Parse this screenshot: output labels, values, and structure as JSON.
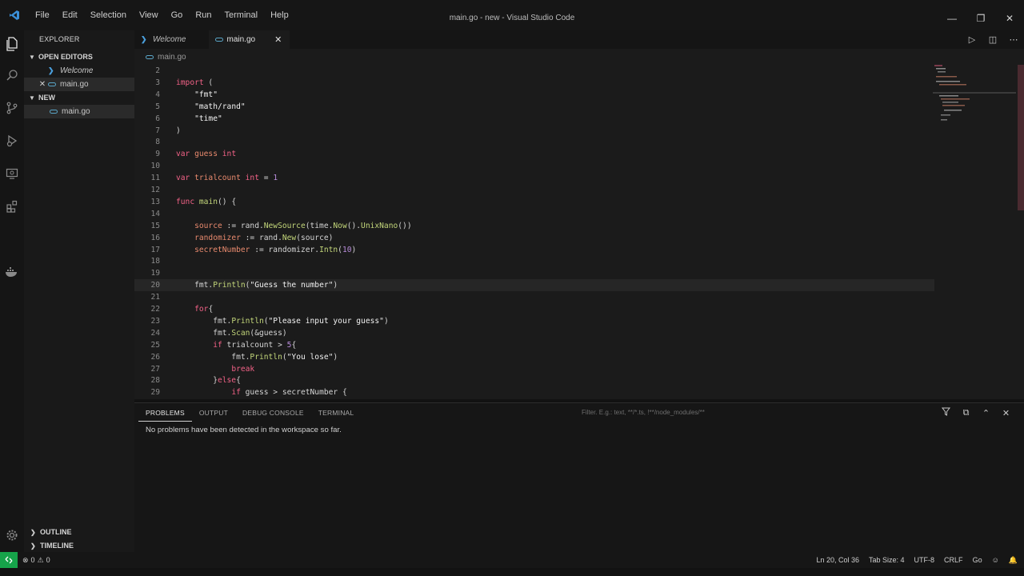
{
  "window": {
    "title": "main.go - new - Visual Studio Code",
    "menu": [
      "File",
      "Edit",
      "Selection",
      "View",
      "Go",
      "Run",
      "Terminal",
      "Help"
    ]
  },
  "sidebar": {
    "header": "EXPLORER",
    "open_editors": {
      "label": "OPEN EDITORS",
      "items": [
        "Welcome",
        "main.go"
      ]
    },
    "folder": {
      "label": "NEW",
      "items": [
        "main.go"
      ]
    },
    "outline": "OUTLINE",
    "timeline": "TIMELINE"
  },
  "tabs": [
    {
      "label": "Welcome",
      "icon": "vscode-icon"
    },
    {
      "label": "main.go",
      "icon": "go-icon",
      "close": "✕"
    }
  ],
  "breadcrumb": "main.go",
  "code_lines": [
    {
      "n": "2",
      "tokens": []
    },
    {
      "n": "3",
      "tokens": [
        [
          "kw",
          "import"
        ],
        [
          "pk",
          " ("
        ]
      ]
    },
    {
      "n": "4",
      "tokens": [
        [
          "pk",
          "    "
        ],
        [
          "str",
          "\"fmt\""
        ]
      ]
    },
    {
      "n": "5",
      "tokens": [
        [
          "pk",
          "    "
        ],
        [
          "str",
          "\"math/rand\""
        ]
      ]
    },
    {
      "n": "6",
      "tokens": [
        [
          "pk",
          "    "
        ],
        [
          "str",
          "\"time\""
        ]
      ]
    },
    {
      "n": "7",
      "tokens": [
        [
          "pk",
          ")"
        ]
      ]
    },
    {
      "n": "8",
      "tokens": []
    },
    {
      "n": "9",
      "tokens": [
        [
          "kw",
          "var"
        ],
        [
          "pk",
          " "
        ],
        [
          "var",
          "guess"
        ],
        [
          "pk",
          " "
        ],
        [
          "ty",
          "int"
        ]
      ]
    },
    {
      "n": "10",
      "tokens": []
    },
    {
      "n": "11",
      "tokens": [
        [
          "kw",
          "var"
        ],
        [
          "pk",
          " "
        ],
        [
          "var",
          "trialcount"
        ],
        [
          "pk",
          " "
        ],
        [
          "ty",
          "int"
        ],
        [
          "pk",
          " = "
        ],
        [
          "num",
          "1"
        ]
      ]
    },
    {
      "n": "12",
      "tokens": []
    },
    {
      "n": "13",
      "tokens": [
        [
          "kw",
          "func"
        ],
        [
          "pk",
          " "
        ],
        [
          "fn",
          "main"
        ],
        [
          "pk",
          "() {"
        ]
      ]
    },
    {
      "n": "14",
      "tokens": []
    },
    {
      "n": "15",
      "tokens": [
        [
          "pk",
          "    "
        ],
        [
          "var",
          "source"
        ],
        [
          "pk",
          " := rand."
        ],
        [
          "fn",
          "NewSource"
        ],
        [
          "pk",
          "(time."
        ],
        [
          "fn",
          "Now"
        ],
        [
          "pk",
          "()."
        ],
        [
          "fn",
          "UnixNano"
        ],
        [
          "pk",
          "())"
        ]
      ]
    },
    {
      "n": "16",
      "tokens": [
        [
          "pk",
          "    "
        ],
        [
          "var",
          "randomizer"
        ],
        [
          "pk",
          " := rand."
        ],
        [
          "fn",
          "New"
        ],
        [
          "pk",
          "(source)"
        ]
      ]
    },
    {
      "n": "17",
      "tokens": [
        [
          "pk",
          "    "
        ],
        [
          "var",
          "secretNumber"
        ],
        [
          "pk",
          " := randomizer."
        ],
        [
          "fn",
          "Intn"
        ],
        [
          "pk",
          "("
        ],
        [
          "num",
          "10"
        ],
        [
          "pk",
          ")"
        ]
      ]
    },
    {
      "n": "18",
      "tokens": []
    },
    {
      "n": "19",
      "tokens": []
    },
    {
      "n": "20",
      "tokens": [
        [
          "pk",
          "    fmt."
        ],
        [
          "fn",
          "Println"
        ],
        [
          "pk",
          "("
        ],
        [
          "str",
          "\"Guess the number\""
        ],
        [
          "pk",
          ")"
        ]
      ]
    },
    {
      "n": "21",
      "tokens": []
    },
    {
      "n": "22",
      "tokens": [
        [
          "pk",
          "    "
        ],
        [
          "kw",
          "for"
        ],
        [
          "pk",
          "{"
        ]
      ]
    },
    {
      "n": "23",
      "tokens": [
        [
          "pk",
          "        fmt."
        ],
        [
          "fn",
          "Println"
        ],
        [
          "pk",
          "("
        ],
        [
          "str",
          "\"Please input your guess\""
        ],
        [
          "pk",
          ")"
        ]
      ]
    },
    {
      "n": "24",
      "tokens": [
        [
          "pk",
          "        fmt."
        ],
        [
          "fn",
          "Scan"
        ],
        [
          "pk",
          "(&guess)"
        ]
      ]
    },
    {
      "n": "25",
      "tokens": [
        [
          "pk",
          "        "
        ],
        [
          "kw",
          "if"
        ],
        [
          "pk",
          " trialcount > "
        ],
        [
          "num",
          "5"
        ],
        [
          "pk",
          "{"
        ]
      ]
    },
    {
      "n": "26",
      "tokens": [
        [
          "pk",
          "            fmt."
        ],
        [
          "fn",
          "Println"
        ],
        [
          "pk",
          "("
        ],
        [
          "str",
          "\"You lose\""
        ],
        [
          "pk",
          ")"
        ]
      ]
    },
    {
      "n": "27",
      "tokens": [
        [
          "pk",
          "            "
        ],
        [
          "kw",
          "break"
        ]
      ]
    },
    {
      "n": "28",
      "tokens": [
        [
          "pk",
          "        }"
        ],
        [
          "kw",
          "else"
        ],
        [
          "pk",
          "{"
        ]
      ]
    },
    {
      "n": "29",
      "tokens": [
        [
          "pk",
          "            "
        ],
        [
          "kw",
          "if"
        ],
        [
          "pk",
          " guess > secretNumber {"
        ]
      ]
    }
  ],
  "panel": {
    "tabs": [
      "PROBLEMS",
      "OUTPUT",
      "DEBUG CONSOLE",
      "TERMINAL"
    ],
    "filter_placeholder": "Filter. E.g.: text, **/*.ts, !**/node_modules/**",
    "message": "No problems have been detected in the workspace so far."
  },
  "statusbar": {
    "errors": "0",
    "warnings": "0",
    "position": "Ln 20, Col 36",
    "tab_size": "Tab Size: 4",
    "encoding": "UTF-8",
    "eol": "CRLF",
    "language": "Go"
  },
  "colors": {
    "remote": "#16a34a",
    "keyword": "#f26287",
    "string": "#f2f2f2",
    "function": "#c3d67a",
    "variable": "#e98a6e",
    "number": "#b98ddc"
  }
}
